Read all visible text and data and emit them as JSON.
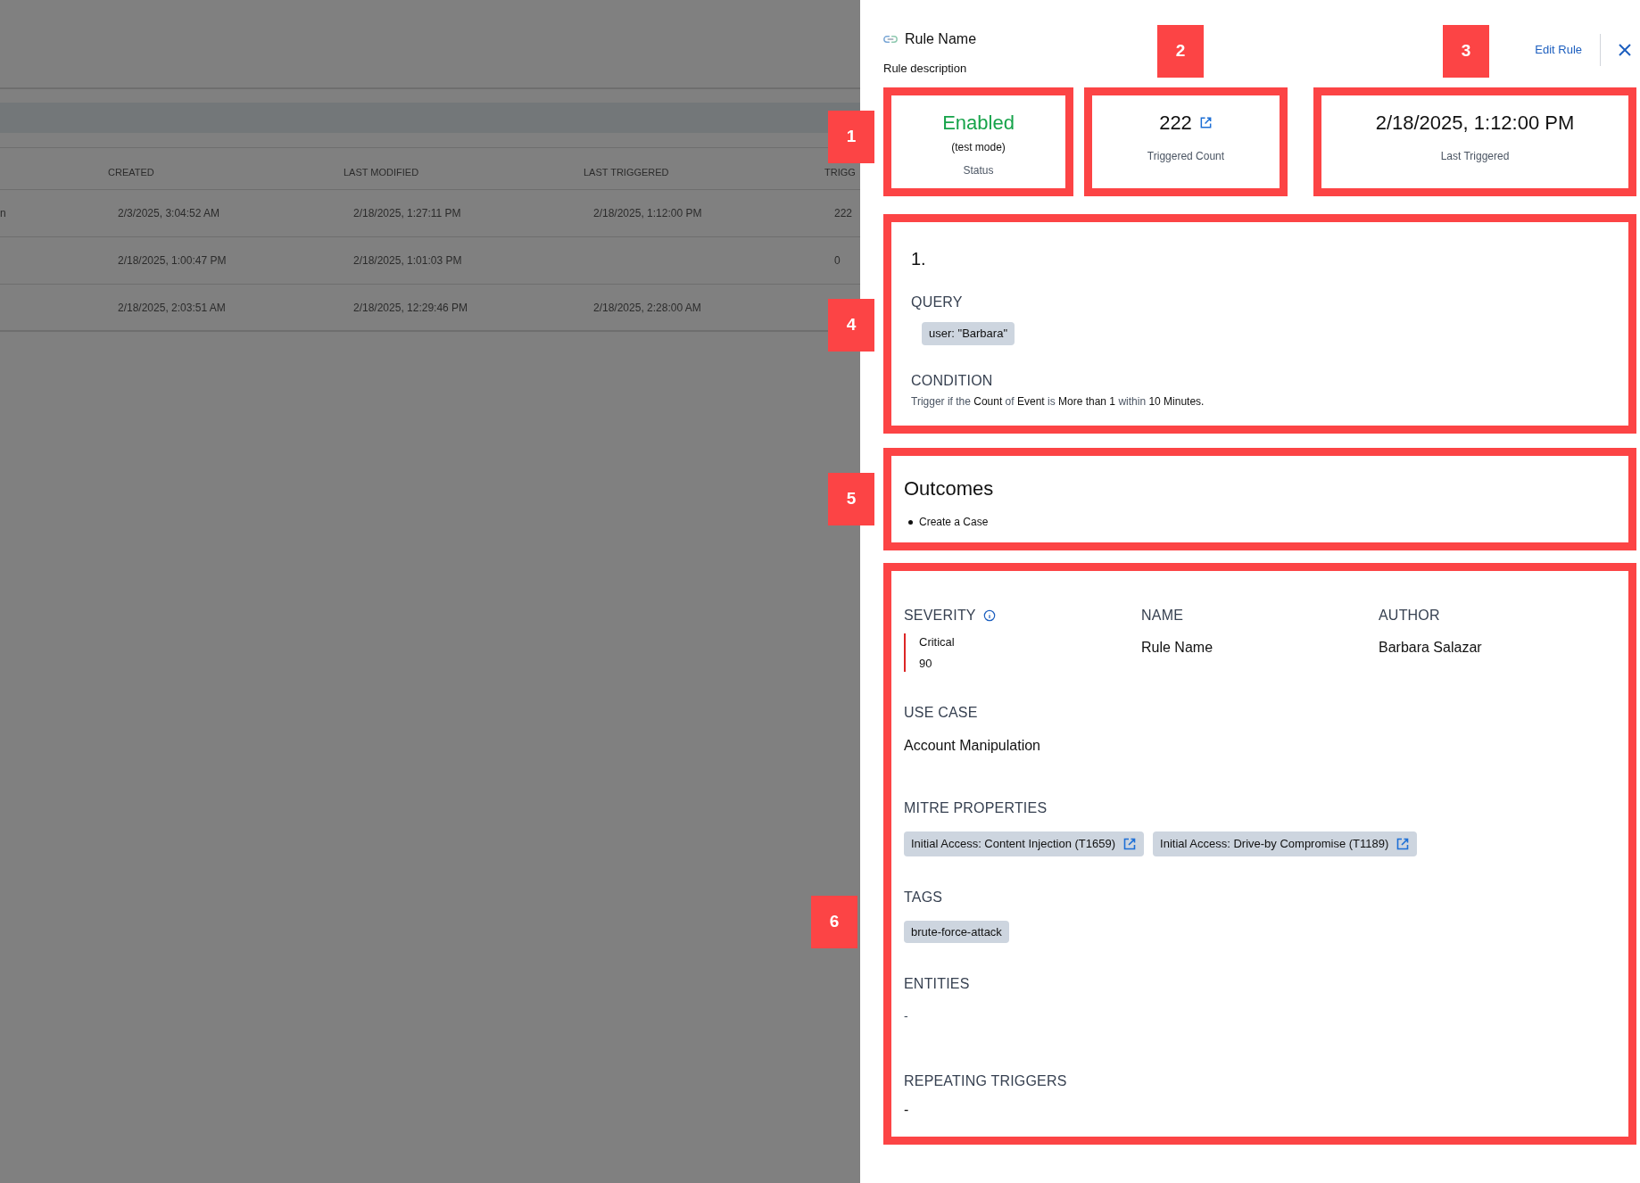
{
  "background_table": {
    "columns": [
      "CREATED",
      "LAST MODIFIED",
      "LAST TRIGGERED",
      "TRIGG"
    ],
    "rows": [
      {
        "column_1": "n",
        "cells": [
          "2/3/2025, 3:04:52 AM",
          "2/18/2025, 1:27:11 PM",
          "2/18/2025, 1:12:00 PM",
          "222"
        ]
      },
      {
        "column_1": "",
        "cells": [
          "2/18/2025, 1:00:47 PM",
          "2/18/2025, 1:01:03 PM",
          "",
          "0"
        ]
      },
      {
        "column_1": "",
        "cells": [
          "2/18/2025, 2:03:51 AM",
          "2/18/2025, 12:29:46 PM",
          "2/18/2025, 2:28:00 AM",
          ""
        ]
      }
    ]
  },
  "panel": {
    "title": "Rule Name",
    "description": "Rule description",
    "edit_button": "Edit Rule",
    "stats": [
      {
        "kind": "status",
        "value": "Enabled",
        "note": "(test mode)",
        "label": "Status"
      },
      {
        "kind": "count",
        "value": "222",
        "label": "Triggered Count"
      },
      {
        "kind": "date",
        "value": "2/18/2025, 1:12:00 PM",
        "label": "Last Triggered"
      }
    ],
    "query_block": {
      "index": "1.",
      "query_heading": "QUERY",
      "query": "user: \"Barbara\"",
      "condition_heading": "CONDITION",
      "condition": [
        {
          "text": "Trigger if the ",
          "emphasis": false
        },
        {
          "text": "Count",
          "emphasis": true
        },
        {
          "text": " of ",
          "emphasis": false
        },
        {
          "text": "Event",
          "emphasis": true
        },
        {
          "text": " is ",
          "emphasis": false
        },
        {
          "text": "More than 1",
          "emphasis": true
        },
        {
          "text": " within ",
          "emphasis": false
        },
        {
          "text": "10 Minutes.",
          "emphasis": true
        }
      ]
    },
    "outcomes": {
      "heading": "Outcomes",
      "items": [
        "Create a Case"
      ]
    },
    "details": {
      "severity": {
        "heading": "SEVERITY",
        "level": "Critical",
        "score": "90",
        "color": "#dc2626"
      },
      "name": {
        "heading": "NAME",
        "value": "Rule Name"
      },
      "author": {
        "heading": "AUTHOR",
        "value": "Barbara Salazar"
      },
      "use_case": {
        "heading": "USE CASE",
        "value": "Account Manipulation"
      },
      "mitre": {
        "heading": "MITRE PROPERTIES",
        "items": [
          "Initial Access: Content Injection (T1659)",
          "Initial Access: Drive-by Compromise (T1189)"
        ]
      },
      "tags": {
        "heading": "TAGS",
        "items": [
          "brute-force-attack"
        ]
      },
      "entities": {
        "heading": "ENTITIES",
        "value": "-"
      },
      "repeating": {
        "heading": "REPEATING TRIGGERS",
        "value": "-"
      }
    }
  },
  "callouts": [
    "1",
    "2",
    "3",
    "4",
    "5",
    "6"
  ]
}
